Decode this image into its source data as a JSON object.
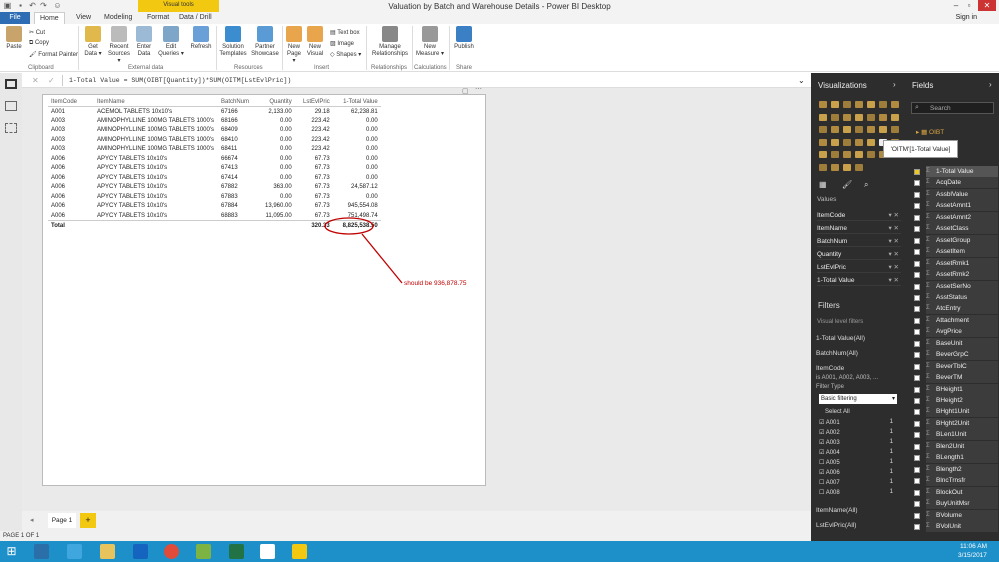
{
  "window": {
    "title": "Valuation by Batch and Warehouse Details - Power BI Desktop",
    "visual_tools": "Visual tools",
    "sign_in": "Sign in"
  },
  "tabs": [
    {
      "label": "File"
    },
    {
      "label": "Home"
    },
    {
      "label": "View"
    },
    {
      "label": "Modeling"
    },
    {
      "label": "Format"
    },
    {
      "label": "Data / Drill"
    }
  ],
  "ribbon": {
    "clipboard": {
      "paste": "Paste",
      "cut": "Cut",
      "copy": "Copy",
      "format_painter": "Format Painter",
      "group": "Clipboard"
    },
    "external": {
      "get_data": "Get Data",
      "recent_sources": "Recent Sources",
      "enter_data": "Enter Data",
      "edit_queries": "Edit Queries",
      "refresh": "Refresh",
      "group": "External data"
    },
    "resources": {
      "solution_templates": "Solution Templates",
      "partner_showcase": "Partner Showcase",
      "group": "Resources"
    },
    "insert": {
      "new_page": "New Page",
      "new_visual": "New Visual",
      "text_box": "Text box",
      "image": "Image",
      "shapes": "Shapes",
      "group": "Insert"
    },
    "relationships": {
      "manage": "Manage Relationships",
      "group": "Relationships"
    },
    "calculations": {
      "new_measure": "New Measure",
      "group": "Calculations"
    },
    "share": {
      "publish": "Publish",
      "group": "Share"
    }
  },
  "formula": {
    "text": "1-Total Value = SUM(OIBT[Quantity])*SUM(OITM[LstEvlPric])"
  },
  "table": {
    "headers": [
      "ItemCode",
      "ItemName",
      "BatchNum",
      "Quantity",
      "LstEvlPric",
      "1-Total Value"
    ],
    "rows": [
      [
        "A001",
        "ACEMOL TABLETS 10x10's",
        "67166",
        "2,133.00",
        "29.18",
        "62,238.81"
      ],
      [
        "A003",
        "AMINOPHYLLINE 100MG TABLETS 1000's",
        "68166",
        "0.00",
        "223.42",
        "0.00"
      ],
      [
        "A003",
        "AMINOPHYLLINE 100MG TABLETS 1000's",
        "68409",
        "0.00",
        "223.42",
        "0.00"
      ],
      [
        "A003",
        "AMINOPHYLLINE 100MG TABLETS 1000's",
        "68410",
        "0.00",
        "223.42",
        "0.00"
      ],
      [
        "A003",
        "AMINOPHYLLINE 100MG TABLETS 1000's",
        "68411",
        "0.00",
        "223.42",
        "0.00"
      ],
      [
        "A006",
        "APYCY TABLETS 10x10's",
        "66674",
        "0.00",
        "67.73",
        "0.00"
      ],
      [
        "A006",
        "APYCY TABLETS 10x10's",
        "67413",
        "0.00",
        "67.73",
        "0.00"
      ],
      [
        "A006",
        "APYCY TABLETS 10x10's",
        "67414",
        "0.00",
        "67.73",
        "0.00"
      ],
      [
        "A006",
        "APYCY TABLETS 10x10's",
        "67882",
        "363.00",
        "67.73",
        "24,587.12"
      ],
      [
        "A006",
        "APYCY TABLETS 10x10's",
        "67883",
        "0.00",
        "67.73",
        "0.00"
      ],
      [
        "A006",
        "APYCY TABLETS 10x10's",
        "67884",
        "13,960.00",
        "67.73",
        "945,554.08"
      ],
      [
        "A006",
        "APYCY TABLETS 10x10's",
        "68883",
        "11,095.00",
        "67.73",
        "751,498.74"
      ]
    ],
    "total": {
      "label": "Total",
      "lstevlpric": "320.33",
      "value": "8,825,538.50"
    }
  },
  "annotation": {
    "text": "should be 936,878.75",
    "color": "#c00000"
  },
  "pages": {
    "tab": "Page 1",
    "add": "+"
  },
  "status": {
    "text": "PAGE 1 OF 1"
  },
  "viz": {
    "title": "Visualizations",
    "values_label": "Values",
    "wells": [
      "ItemCode",
      "ItemName",
      "BatchNum",
      "Quantity",
      "LstEvlPric",
      "1-Total Value"
    ],
    "filters_title": "Filters",
    "visual_level": "Visual level filters",
    "filters": [
      "1-Total Value(All)",
      "BatchNum(All)"
    ],
    "itemcode_filter": {
      "title": "ItemCode",
      "summary": "is A001, A002, A003, ...",
      "type_label": "Filter Type",
      "type_value": "Basic filtering",
      "select_all": "Select All",
      "options": [
        {
          "code": "A001",
          "count": "1"
        },
        {
          "code": "A002",
          "count": "1"
        },
        {
          "code": "A003",
          "count": "1"
        },
        {
          "code": "A004",
          "count": "1"
        },
        {
          "code": "A005",
          "count": "1"
        },
        {
          "code": "A006",
          "count": "1"
        },
        {
          "code": "A007",
          "count": "1"
        },
        {
          "code": "A008",
          "count": "1"
        }
      ]
    },
    "bottom_filters": [
      "ItemName(All)",
      "LstEvlPric(All)"
    ]
  },
  "fields": {
    "title": "Fields",
    "search_placeholder": "Search",
    "table_name": "OIBT",
    "tooltip": "'OITM'[1-Total Value]",
    "items": [
      "1-Total Value",
      "AcqDate",
      "AssblValue",
      "AssetAmnt1",
      "AssetAmnt2",
      "AssetClass",
      "AssetGroup",
      "AssetItem",
      "AssetRmk1",
      "AssetRmk2",
      "AssetSerNo",
      "AsstStatus",
      "AtcEntry",
      "Attachment",
      "AvgPrice",
      "BaseUnit",
      "BeverGrpC",
      "BeverTblC",
      "BeverTM",
      "BHeight1",
      "BHeight2",
      "BHght1Unit",
      "BHght2Unit",
      "BLen1Unit",
      "Blen2Unit",
      "BLength1",
      "Blength2",
      "BlncTrnsfr",
      "BlockOut",
      "BuyUnitMsr",
      "BVolume",
      "BVolUnit"
    ]
  },
  "taskbar": {
    "time": "11:06 AM",
    "date": "3/15/2017"
  }
}
